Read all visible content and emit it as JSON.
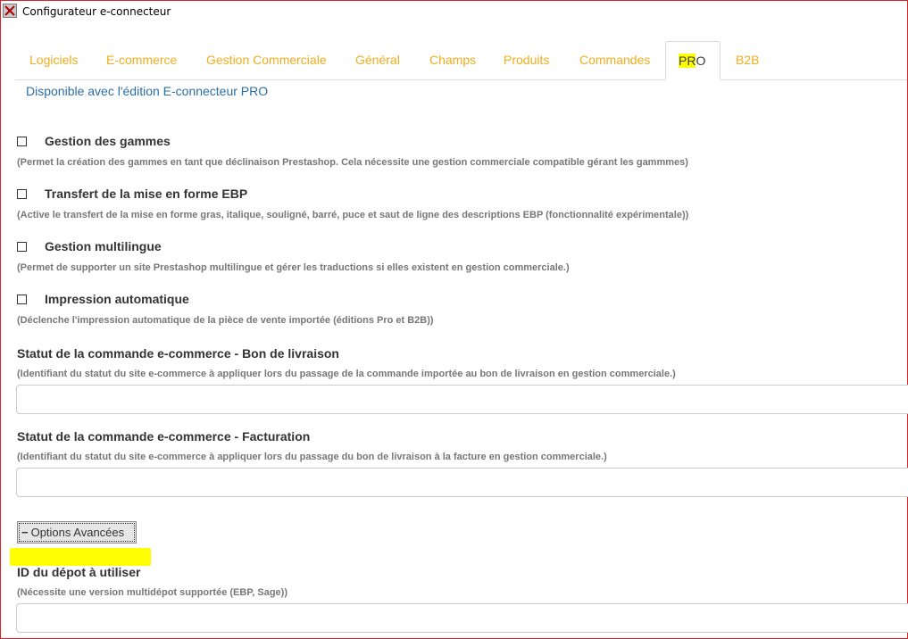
{
  "window": {
    "title": "Configurateur e-connecteur",
    "icon": "app-close-icon"
  },
  "tabs": [
    {
      "label": "Logiciels",
      "active": false
    },
    {
      "label": "E-commerce",
      "active": false
    },
    {
      "label": "Gestion Commerciale",
      "active": false
    },
    {
      "label": "Général",
      "active": false
    },
    {
      "label": "Champs",
      "active": false
    },
    {
      "label": "Produits",
      "active": false
    },
    {
      "label": "Commandes",
      "active": false
    },
    {
      "label": "PRO",
      "active": true,
      "highlighted_part": "PR",
      "rest": "O"
    },
    {
      "label": "B2B",
      "active": false
    }
  ],
  "availability_notice": "Disponible avec l'édition E-connecteur PRO",
  "options": [
    {
      "label": "Gestion des gammes",
      "checked": false,
      "help": "(Permet la création des gammes en tant que déclinaison Prestashop. Cela nécessite une gestion commerciale compatible gérant les gammmes)"
    },
    {
      "label": "Transfert de la mise en forme EBP",
      "checked": false,
      "help": "(Active le transfert de la mise en forme gras, italique, souligné, barré, puce et saut de ligne des descriptions EBP (fonctionnalité expérimentale))"
    },
    {
      "label": "Gestion multilingue",
      "checked": false,
      "help": "(Permet de supporter un site Prestashop multilingue et gérer les traductions si elles existent en gestion commerciale.)"
    },
    {
      "label": "Impression automatique",
      "checked": false,
      "help": "(Déclenche l'impression automatique de la pièce de vente importée (éditions Pro et B2B))"
    }
  ],
  "fields": {
    "delivery_status": {
      "label": "Statut de la commande e-commerce - Bon de livraison",
      "help": "(Identifiant du statut du site e-commerce à appliquer lors du passage de la commande importée au bon de livraison en gestion commerciale.)",
      "value": ""
    },
    "billing_status": {
      "label": "Statut de la commande e-commerce - Facturation",
      "help": "(Identifiant du statut du site e-commerce à appliquer lors du passage du bon de livraison à la facture en gestion commerciale.)",
      "value": ""
    },
    "warehouse_id": {
      "label": "ID du dépot à utiliser",
      "help": "(Nécessite une version multidépot supportée (EBP, Sage))",
      "value": ""
    }
  },
  "advanced_button": {
    "symbol": "−",
    "label": "Options Avancées"
  },
  "colors": {
    "tab_text": "#f0ad1e",
    "link_blue": "#2c6fa4",
    "annotation_yellow": "#ffff00",
    "window_border": "#d9242a"
  }
}
